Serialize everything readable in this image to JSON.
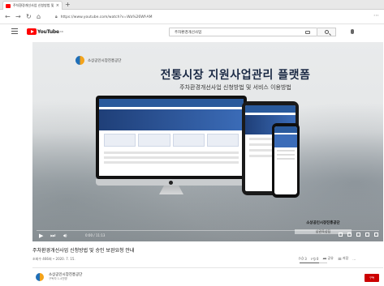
{
  "browser": {
    "tab_title": "주차환경개선사업 신청방법 및",
    "tab_close": "×",
    "new_tab": "+",
    "url": "https://www.youtube.com/watch?v=Wa%26Wf-AM",
    "icons": [
      "back-icon",
      "forward-icon",
      "reload-icon",
      "home-icon",
      "lock-icon",
      "more-icon"
    ]
  },
  "masthead": {
    "logo_text": "YouTube",
    "logo_region": "KR",
    "search_value": "주차환경개선사업",
    "icons": [
      "menu-icon",
      "keyboard-icon",
      "search-icon",
      "mic-icon"
    ]
  },
  "video": {
    "org_name": "소상공인시장진흥공단",
    "title": "전통시장 지원사업관리 플랫폼",
    "subtitle": "주차환경개선사업 신청방법 및 서비스 이용방법",
    "watermark_line1": "소상공인시장진흥공단",
    "watermark_line2": "상권육성팀",
    "time": "0:00 / 11:13",
    "progress": 0.0
  },
  "below": {
    "title": "주차환경개선사업 신청방법 및 승인 보완요청 안내",
    "views": "조회수 466회 • 2020. 7. 15.",
    "like_count": "3",
    "dislike_count": "0",
    "share_label": "공유",
    "save_label": "저장",
    "more_label": "…",
    "like_ratio": 0.7
  },
  "channel": {
    "name": "소상공인시장진흥공단",
    "subs": "구독자 1.4천명",
    "subscribe_label": "구독"
  },
  "colors": {
    "brand_red": "#ff0000",
    "subscribe_red": "#cc0000",
    "title_navy": "#1b2a45"
  }
}
